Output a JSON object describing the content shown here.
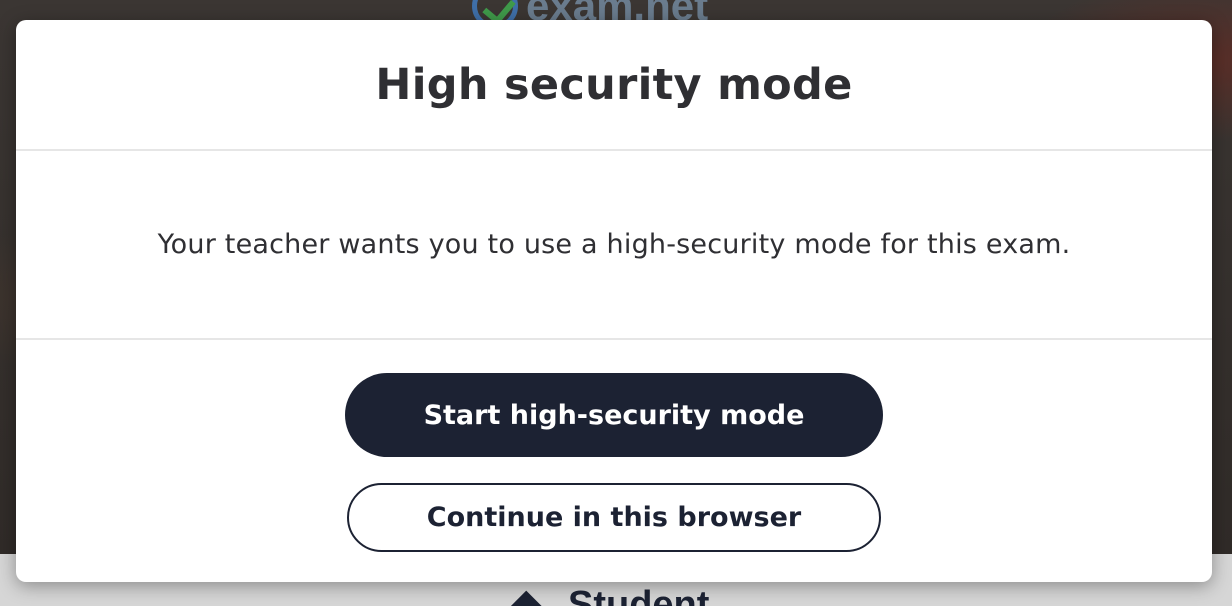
{
  "background": {
    "logo_text": "exam.net",
    "student_label": "Student"
  },
  "modal": {
    "title": "High security mode",
    "message": "Your teacher wants you to use a high-security mode for this exam.",
    "primary_button": "Start high-security mode",
    "secondary_button": "Continue in this browser"
  },
  "colors": {
    "primary_dark": "#1c2233",
    "modal_background": "#ffffff",
    "divider": "#e6e6e6",
    "text": "#2f2f33"
  },
  "icons": {
    "logo": "exam-net-logo-icon",
    "student": "graduation-cap-icon"
  }
}
